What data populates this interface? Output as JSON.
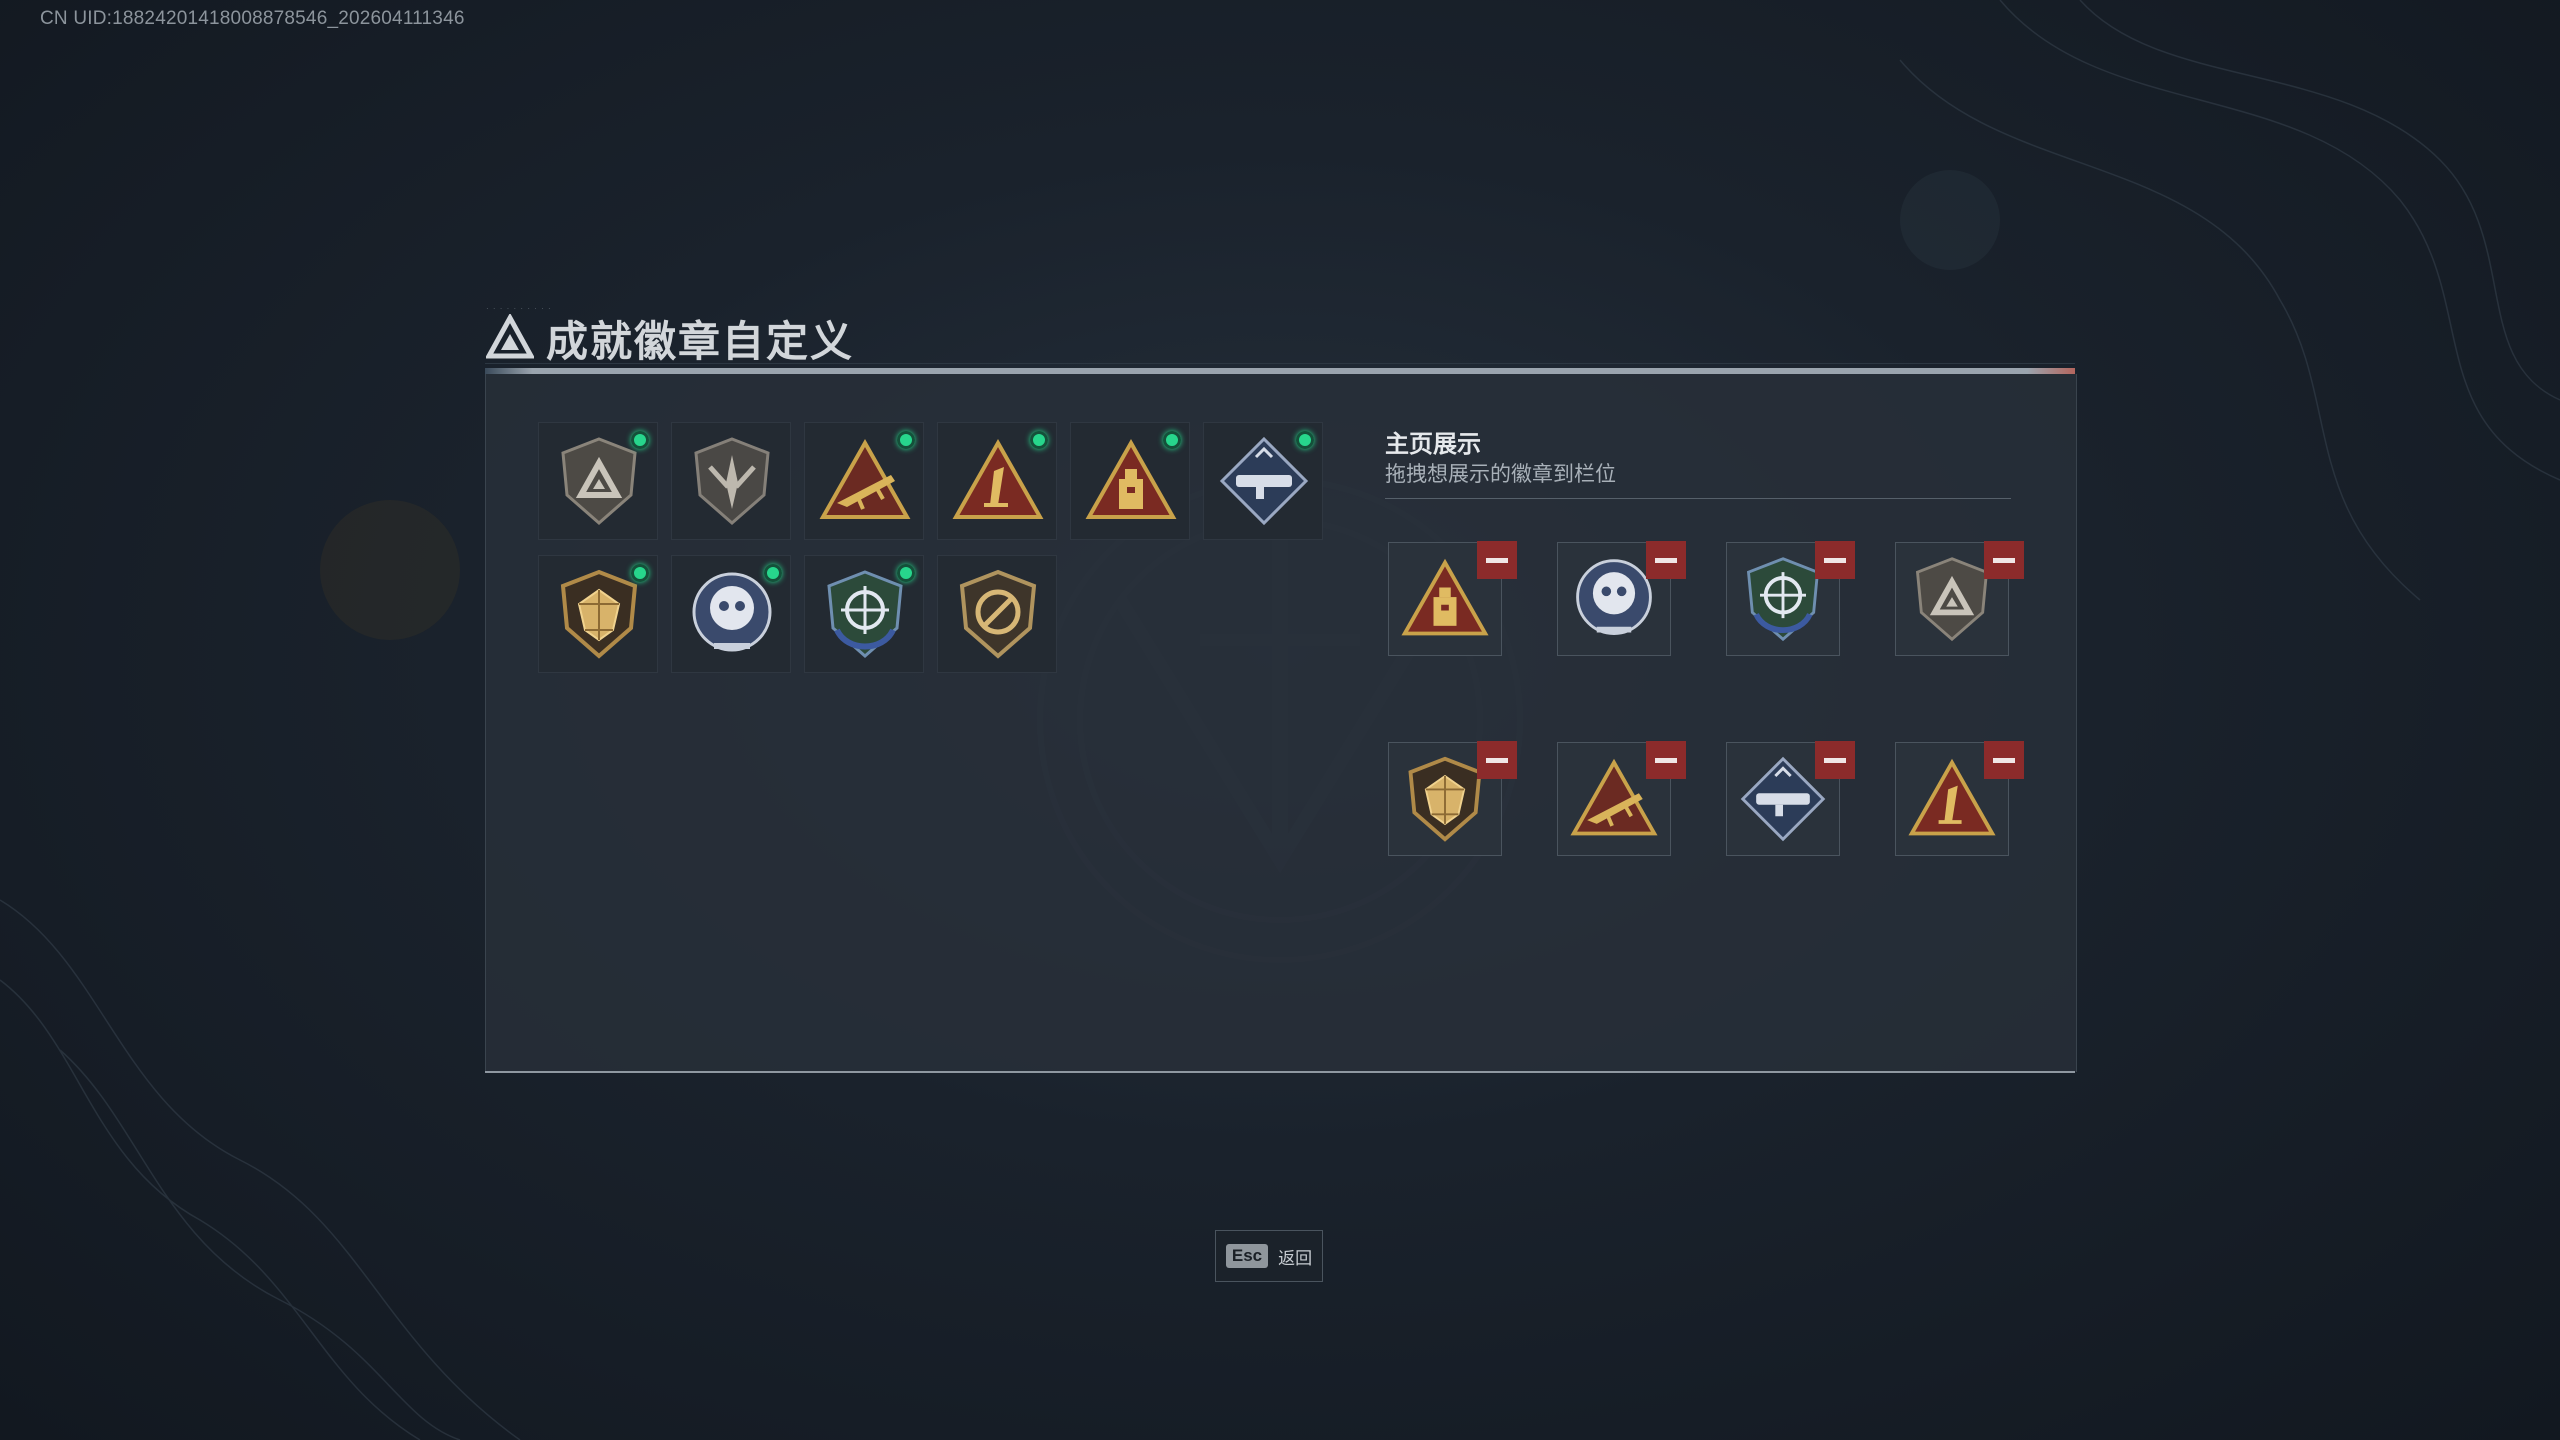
{
  "uid_text": "CN UID:18824201418008878546_202604111346",
  "title": "成就徽章自定义",
  "showcase": {
    "title": "主页展示",
    "subtitle": "拖拽想展示的徽章到栏位"
  },
  "owned_badges": [
    {
      "icon": "gray-triangle-shield-badge-icon",
      "new": true
    },
    {
      "icon": "gray-dagger-shield-badge-icon",
      "new": false
    },
    {
      "icon": "gold-rifle-triangle-badge-icon",
      "new": true
    },
    {
      "icon": "red-number-one-triangle-badge-icon",
      "new": true
    },
    {
      "icon": "red-tower-triangle-badge-icon",
      "new": true
    },
    {
      "icon": "blue-launcher-diamond-badge-icon",
      "new": true
    },
    {
      "icon": "gold-gem-shield-badge-icon",
      "new": true
    },
    {
      "icon": "silver-skull-crest-badge-icon",
      "new": true
    },
    {
      "icon": "blue-crosshair-shield-badge-icon",
      "new": true
    },
    {
      "icon": "gold-no-knife-shield-badge-icon",
      "new": false
    }
  ],
  "displayed_badges": [
    {
      "icon": "red-tower-triangle-badge-icon"
    },
    {
      "icon": "silver-skull-crest-badge-icon"
    },
    {
      "icon": "blue-crosshair-shield-badge-icon"
    },
    {
      "icon": "gray-triangle-shield-badge-icon"
    },
    {
      "icon": "gold-gem-shield-badge-icon"
    },
    {
      "icon": "gold-rifle-triangle-badge-icon"
    },
    {
      "icon": "blue-launcher-diamond-badge-icon"
    },
    {
      "icon": "red-number-one-triangle-badge-icon"
    }
  ],
  "footer": {
    "esc_key": "Esc",
    "back_label": "返回"
  },
  "colors": {
    "new_dot": "#27d68c",
    "remove_button": "#8c2b2b",
    "accent_red": "#b4665e"
  }
}
